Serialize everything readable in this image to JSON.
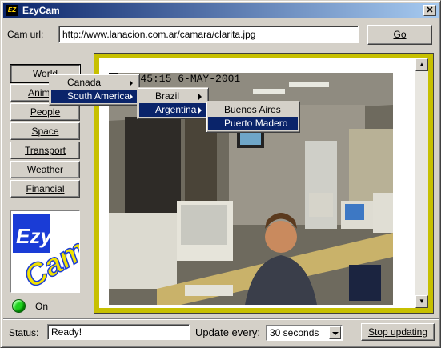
{
  "window": {
    "title": "EzyCam",
    "close_glyph": "✕",
    "icon": "ezycam-app-icon"
  },
  "url_bar": {
    "label": "Cam url:",
    "value": "http://www.lanacion.com.ar/camara/clarita.jpg",
    "go_label": "Go"
  },
  "categories": [
    {
      "label": "World"
    },
    {
      "label": "Animals"
    },
    {
      "label": "People"
    },
    {
      "label": "Space"
    },
    {
      "label": "Transport"
    },
    {
      "label": "Weather"
    },
    {
      "label": "Financial"
    }
  ],
  "menus": {
    "level1": [
      {
        "label": "Canada",
        "selected": false
      },
      {
        "label": "South America",
        "selected": true
      }
    ],
    "level2": [
      {
        "label": "Brazil",
        "selected": false
      },
      {
        "label": "Argentina",
        "selected": true
      }
    ],
    "level3": [
      {
        "label": "Buenos Aires",
        "selected": false
      },
      {
        "label": "Puerto Madero",
        "selected": true
      }
    ]
  },
  "logo": {
    "text_top": "Ezy",
    "text_bottom": "Cam"
  },
  "power": {
    "label": "On",
    "color": "#1fd21f"
  },
  "webcam": {
    "timestamp": "15:45:15  6-MAY-2001"
  },
  "status": {
    "label": "Status:",
    "value": "Ready!",
    "update_label": "Update every:",
    "interval": "30 seconds",
    "stop_label": "Stop updating"
  },
  "colors": {
    "title_start": "#0a246a",
    "title_end": "#a6caf0",
    "frame": "#c7c000",
    "menu_highlight": "#0a246a"
  }
}
